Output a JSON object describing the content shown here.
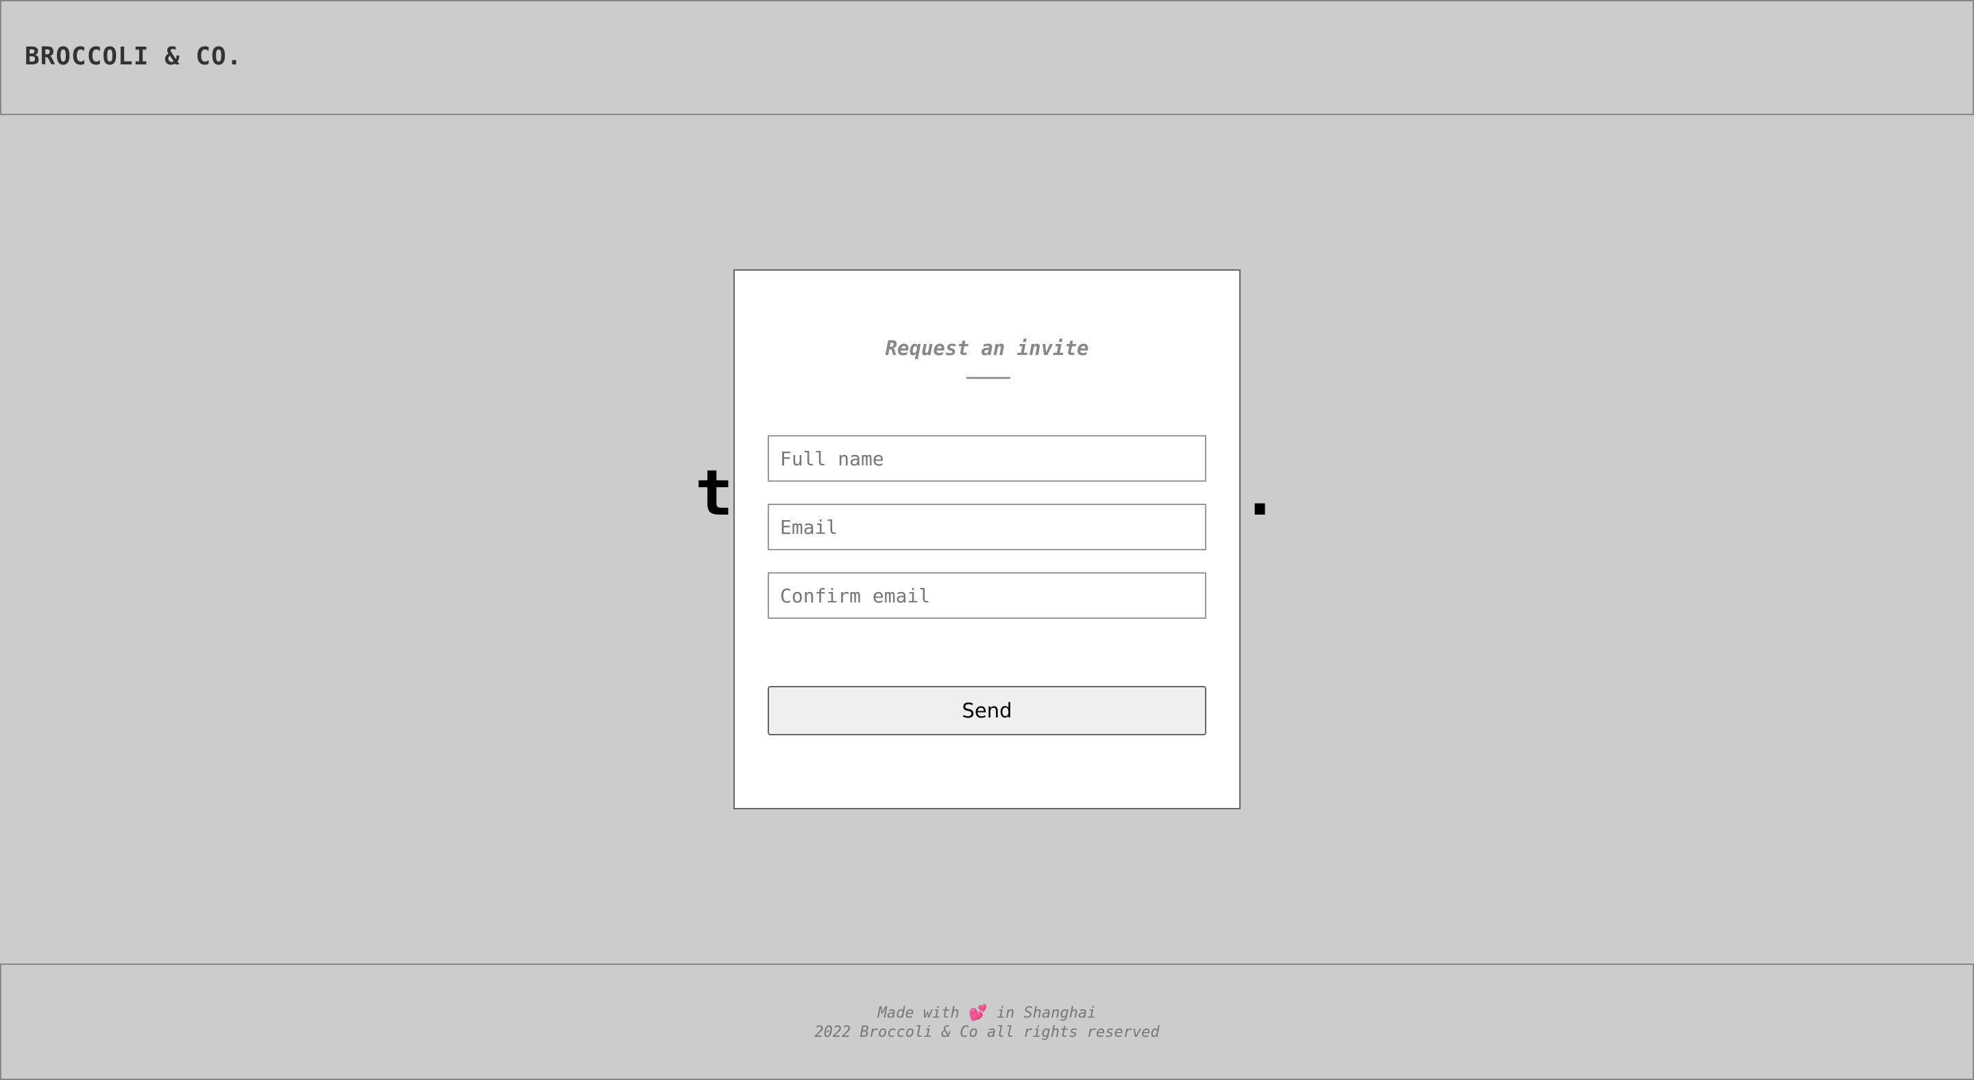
{
  "header": {
    "logo": "BROCCOLI & CO."
  },
  "hero": {
    "text": "to",
    "text_end": "y."
  },
  "modal": {
    "title": "Request an invite",
    "fields": {
      "full_name_placeholder": "Full name",
      "email_placeholder": "Email",
      "confirm_email_placeholder": "Confirm email"
    },
    "send_label": "Send"
  },
  "footer": {
    "made_with_prefix": "Made with",
    "heart": "💕",
    "made_with_suffix": "in Shanghai",
    "copyright": "2022 Broccoli & Co all rights reserved"
  },
  "colors": {
    "background": "#cccccc",
    "modal_background": "#ffffff",
    "heart": "#c2185b"
  }
}
